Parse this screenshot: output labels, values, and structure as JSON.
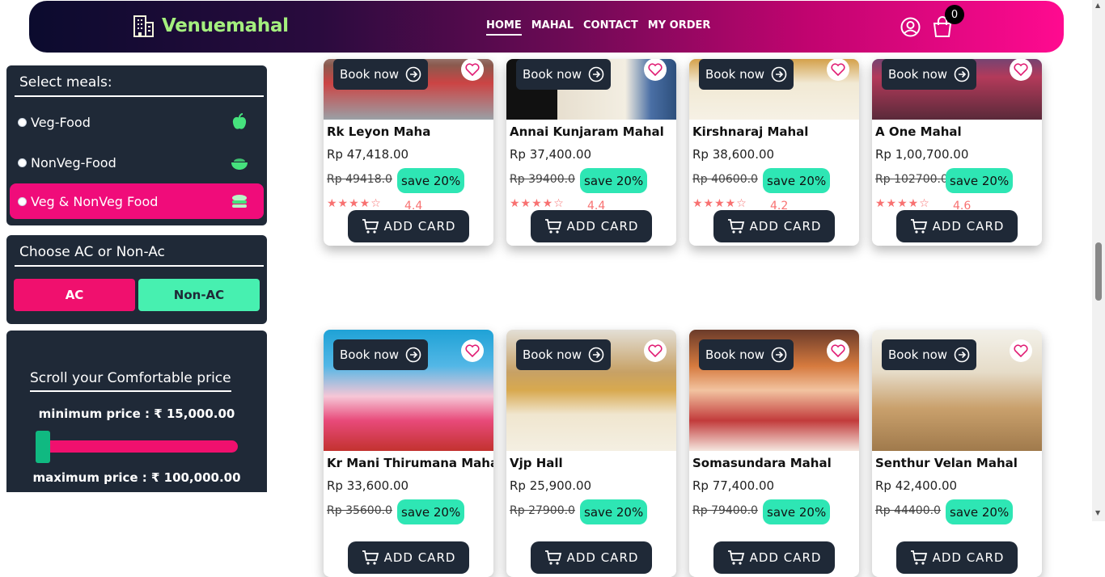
{
  "header": {
    "brand": "Venuemahal",
    "nav": [
      "HOME",
      "MAHAL",
      "CONTACT",
      "MY ORDER"
    ],
    "active_nav": "HOME",
    "cart_count": "0",
    "colors": {
      "brand_text": "#a4ef7e",
      "gradient_start": "#0b0b2e",
      "gradient_end": "#ff0a90"
    }
  },
  "sidebar": {
    "meals": {
      "title": "Select meals:",
      "items": [
        {
          "label": "Veg-Food",
          "icon": "apple-icon",
          "selected": false
        },
        {
          "label": "NonVeg-Food",
          "icon": "bowl-icon",
          "selected": false
        },
        {
          "label": "Veg & NonVeg Food",
          "icon": "food-icon",
          "selected": true
        }
      ]
    },
    "ac": {
      "title": "Choose AC or Non-Ac",
      "ac_label": "AC",
      "nonac_label": "Non-AC"
    },
    "price": {
      "title": "Scroll your Comfortable price",
      "min_label": "minimum price : ₹ 15,000.00",
      "max_label": "maximum price : ₹ 100,000.00"
    }
  },
  "card_ui": {
    "book_label": "Book now",
    "add_label": "ADD CARD",
    "save_label": "save 20%"
  },
  "cards": [
    {
      "name": "Rk Leyon Maha",
      "price": "Rp 47,418.00",
      "old_price": "Rp 49418.0",
      "rating": "4.4",
      "stars": 4
    },
    {
      "name": "Annai Kunjaram Mahal",
      "price": "Rp 37,400.00",
      "old_price": "Rp 39400.0",
      "rating": "4.4",
      "stars": 4
    },
    {
      "name": "Kirshnaraj Mahal",
      "price": "Rp 38,600.00",
      "old_price": "Rp 40600.0",
      "rating": "4.2",
      "stars": 4
    },
    {
      "name": "A One Mahal",
      "price": "Rp 1,00,700.00",
      "old_price": "Rp 102700.0",
      "rating": "4.6",
      "stars": 4
    },
    {
      "name": "Kr Mani Thirumana Mahal",
      "price": "Rp 33,600.00",
      "old_price": "Rp 35600.0",
      "rating": "",
      "stars": 0
    },
    {
      "name": "Vjp Hall",
      "price": "Rp 25,900.00",
      "old_price": "Rp 27900.0",
      "rating": "",
      "stars": 0
    },
    {
      "name": "Somasundara Mahal",
      "price": "Rp 77,400.00",
      "old_price": "Rp 79400.0",
      "rating": "",
      "stars": 0
    },
    {
      "name": "Senthur Velan Mahal",
      "price": "Rp 42,400.00",
      "old_price": "Rp 44400.0",
      "rating": "",
      "stars": 0
    }
  ]
}
